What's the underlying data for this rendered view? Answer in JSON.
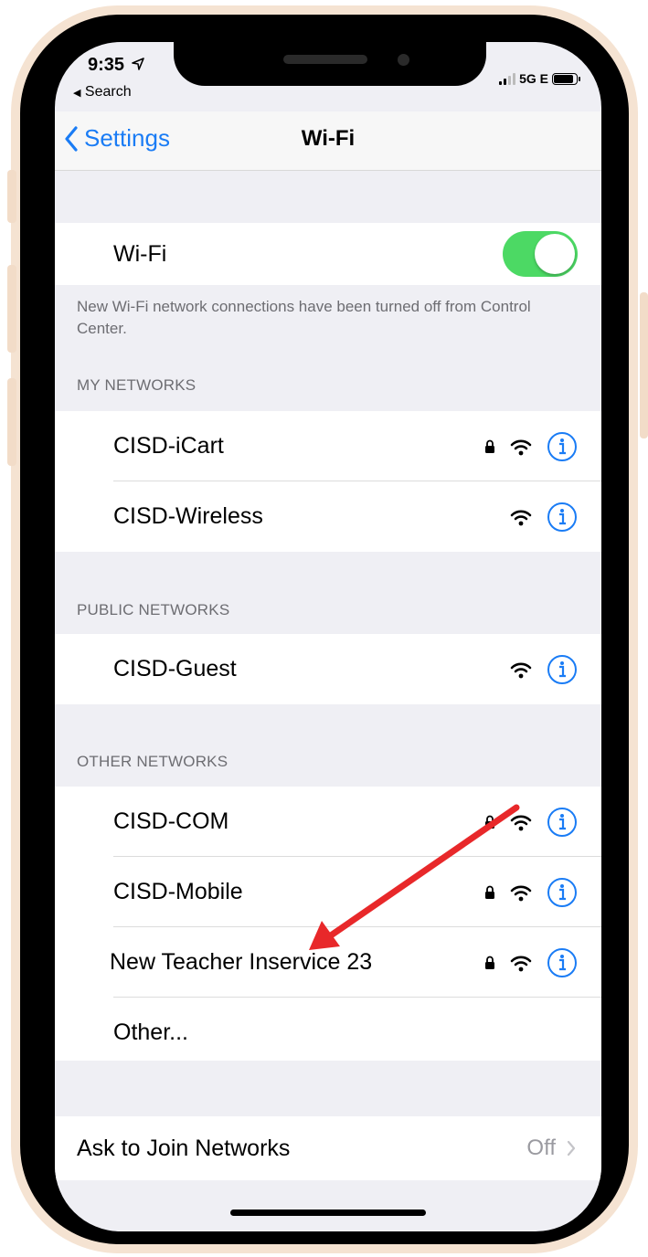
{
  "status": {
    "time": "9:35",
    "back_app": "Search",
    "network": "5G E"
  },
  "nav": {
    "back_label": "Settings",
    "title": "Wi-Fi"
  },
  "wifi_row": {
    "label": "Wi-Fi",
    "enabled": true,
    "toggle_color": "#4cd964"
  },
  "footnote": "New Wi-Fi network connections have been turned off from Control Center.",
  "my_networks": {
    "header": "MY NETWORKS",
    "items": [
      {
        "name": "CISD-iCart",
        "locked": true
      },
      {
        "name": "CISD-Wireless",
        "locked": false
      }
    ]
  },
  "public_networks": {
    "header": "PUBLIC NETWORKS",
    "items": [
      {
        "name": "CISD-Guest",
        "locked": false
      }
    ]
  },
  "other_networks": {
    "header": "OTHER NETWORKS",
    "items": [
      {
        "name": "CISD-COM",
        "locked": true
      },
      {
        "name": "CISD-Mobile",
        "locked": true
      },
      {
        "name": "New Teacher Inservice 23",
        "locked": true
      },
      {
        "name": "Other..."
      }
    ]
  },
  "ask_to_join": {
    "label": "Ask to Join Networks",
    "value": "Off"
  },
  "colors": {
    "accent": "#1a7cf5",
    "annotation_arrow": "#e8282a"
  }
}
